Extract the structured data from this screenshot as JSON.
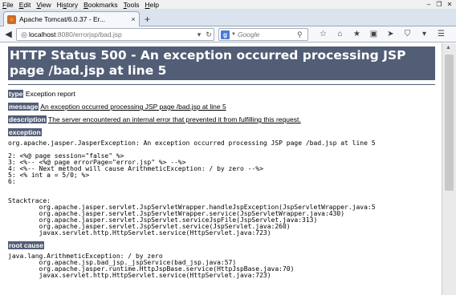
{
  "menu": [
    "File",
    "Edit",
    "View",
    "History",
    "Bookmarks",
    "Tools",
    "Help"
  ],
  "menu_underline": [
    "F",
    "E",
    "V",
    "s",
    "B",
    "T",
    "H"
  ],
  "window_controls": [
    "minimize",
    "restore",
    "close"
  ],
  "tab": {
    "title": "Apache Tomcat/6.0.37 - Er...",
    "close": "×"
  },
  "new_tab": "+",
  "nav": {
    "url_host": "localhost",
    "url_rest": ":8080/errorjsp/bad.jsp",
    "search_placeholder": "Google"
  },
  "toolbar_icons": [
    "star-icon",
    "home-icon",
    "bookmark-star-icon",
    "reading-list-icon",
    "send-icon",
    "shield-icon",
    "dropdown-icon",
    "menu-icon"
  ],
  "page": {
    "heading": "HTTP Status 500 - An exception occurred processing JSP page /bad.jsp at line 5",
    "type_label": "type",
    "type_value": "Exception report",
    "message_label": "message",
    "message_value": "An exception occurred processing JSP page /bad.jsp at line 5",
    "description_label": "description",
    "description_value": "The server encountered an internal error that prevented it from fulfilling this request.",
    "exception_label": "exception",
    "exception_text": "org.apache.jasper.JasperException: An exception occurred processing JSP page /bad.jsp at line 5\n\n2: <%@ page session=\"false\" %>\n3: <%-- <%@ page errorPage=\"error.jsp\" %> --%>\n4: <%-- Next method will cause ArithmeticException: / by zero --%>\n5: <% int a = 5/0; %>\n6:\n\n\nStacktrace:\n\torg.apache.jasper.servlet.JspServletWrapper.handleJspException(JspServletWrapper.java:5\n\torg.apache.jasper.servlet.JspServletWrapper.service(JspServletWrapper.java:430)\n\torg.apache.jasper.servlet.JspServlet.serviceJspFile(JspServlet.java:313)\n\torg.apache.jasper.servlet.JspServlet.service(JspServlet.java:260)\n\tjavax.servlet.http.HttpServlet.service(HttpServlet.java:723)",
    "root_cause_label": "root cause",
    "root_cause_text": "java.lang.ArithmeticException: / by zero\n\torg.apache.jsp.bad_jsp._jspService(bad_jsp.java:57)\n\torg.apache.jasper.runtime.HttpJspBase.service(HttpJspBase.java:70)\n\tjavax.servlet.http.HttpServlet.service(HttpServlet.java:723)"
  },
  "colors": {
    "tomcat_header": "#525d76",
    "menubar": "#f0f0f0",
    "tabstrip": "#dbe3ee"
  }
}
